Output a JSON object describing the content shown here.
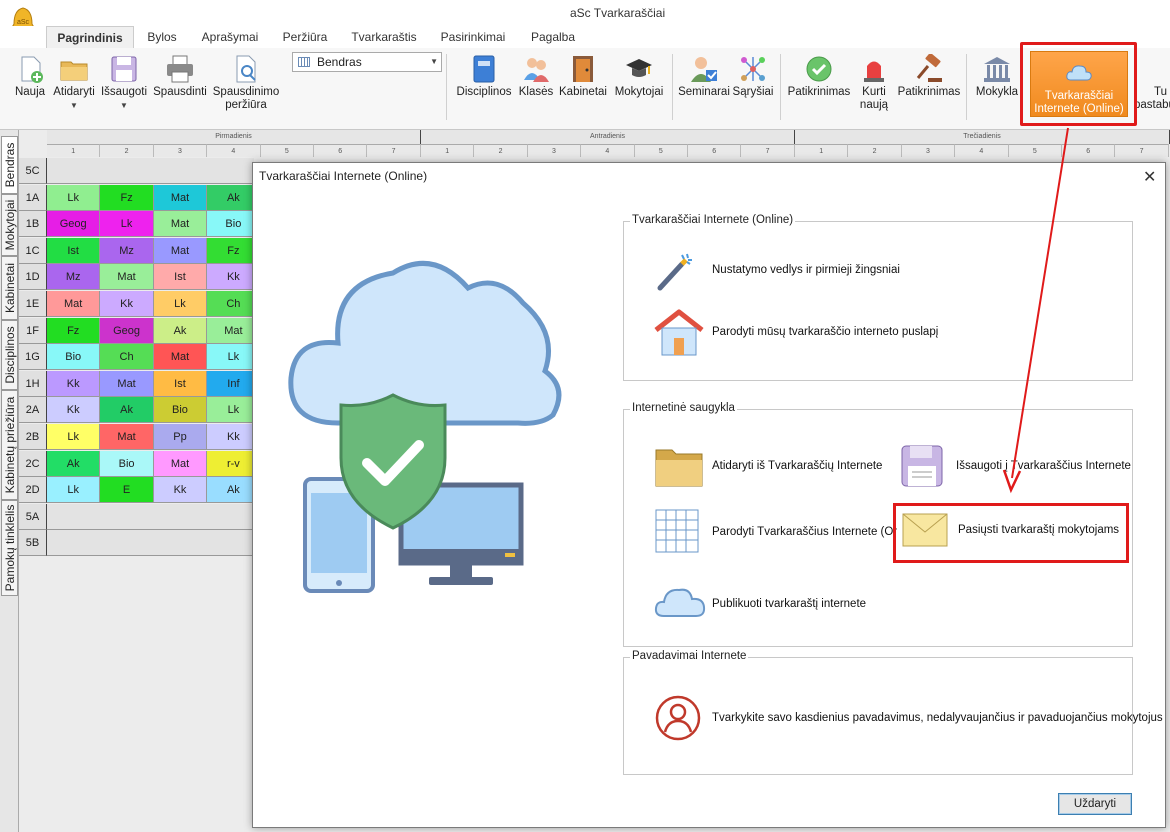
{
  "window": {
    "title": "aSc Tvarkaraščiai",
    "logo_text": "aSc"
  },
  "menu_tabs": [
    "Pagrindinis",
    "Bylos",
    "Aprašymai",
    "Peržiūra",
    "Tvarkaraštis",
    "Pasirinkimai",
    "Pagalba"
  ],
  "ribbon": {
    "buttons": [
      {
        "label": "Nauja",
        "icon": "new-document-icon"
      },
      {
        "label": "Atidaryti",
        "icon": "folder-icon"
      },
      {
        "label": "Išsaugoti",
        "icon": "floppy-icon"
      },
      {
        "label": "Spausdinti",
        "icon": "printer-icon"
      },
      {
        "label": "Spausdinimo",
        "label2": "peržiūra",
        "icon": "print-preview-icon"
      },
      {
        "label": "Disciplinos",
        "icon": "book-icon"
      },
      {
        "label": "Klasės",
        "icon": "students-icon"
      },
      {
        "label": "Kabinetai",
        "icon": "door-icon"
      },
      {
        "label": "Mokytojai",
        "icon": "graduation-cap-icon"
      },
      {
        "label": "Seminarai",
        "icon": "seminar-icon"
      },
      {
        "label": "Sąryšiai",
        "icon": "relations-icon"
      },
      {
        "label": "Patikrinimas",
        "icon": "check-badge-icon"
      },
      {
        "label": "Kurti",
        "label2": "naują",
        "icon": "siren-icon"
      },
      {
        "label": "Patikrinimas",
        "icon": "gavel-icon"
      },
      {
        "label": "Mokykla",
        "icon": "school-icon"
      },
      {
        "label": "Tvarkaraščiai",
        "label2": "Internete (Online)",
        "icon": "cloud-icon"
      },
      {
        "label": "Tu",
        "label2": "pastabų",
        "icon": "notes-icon"
      }
    ],
    "combo_value": "Bendras"
  },
  "side_tabs": [
    "Bendras",
    "Mokytojai",
    "Kabinetai",
    "Disciplinos",
    "Kabinetų priežiūra",
    "Pamokų tinklelis"
  ],
  "grid": {
    "days": [
      "Pirmadienis",
      "Antradienis",
      "Trečiadienis"
    ],
    "periods": [
      "1",
      "2",
      "3",
      "4",
      "5",
      "6",
      "7"
    ],
    "rows": [
      {
        "label": "5C",
        "cells": []
      },
      {
        "label": "1A",
        "cells": [
          [
            "Lk",
            "#90ee90"
          ],
          [
            "Fz",
            "#22dd22"
          ],
          [
            "Mat",
            "#1ec8d8"
          ],
          [
            "Ak",
            "#33cc66"
          ]
        ]
      },
      {
        "label": "1B",
        "cells": [
          [
            "Geog",
            "#e61ee6"
          ],
          [
            "Lk",
            "#ee22ee"
          ],
          [
            "Mat",
            "#99ee99"
          ],
          [
            "Bio",
            "#88f8f8"
          ]
        ]
      },
      {
        "label": "1C",
        "cells": [
          [
            "Ist",
            "#22dd44"
          ],
          [
            "Mz",
            "#aa66ee"
          ],
          [
            "Mat",
            "#9999ff"
          ],
          [
            "Fz",
            "#33dd33"
          ]
        ]
      },
      {
        "label": "1D",
        "cells": [
          [
            "Mz",
            "#aa66ee"
          ],
          [
            "Mat",
            "#99ee99"
          ],
          [
            "Ist",
            "#ffaaaa"
          ],
          [
            "Kk",
            "#ccaaff"
          ]
        ]
      },
      {
        "label": "1E",
        "cells": [
          [
            "Mat",
            "#ff9999"
          ],
          [
            "Kk",
            "#ccaaff"
          ],
          [
            "Lk",
            "#ffcc66"
          ],
          [
            "Ch",
            "#55dd55"
          ]
        ]
      },
      {
        "label": "1F",
        "cells": [
          [
            "Fz",
            "#22dd22"
          ],
          [
            "Geog",
            "#cc33cc"
          ],
          [
            "Ak",
            "#ccee88"
          ],
          [
            "Mat",
            "#99ee99"
          ]
        ]
      },
      {
        "label": "1G",
        "cells": [
          [
            "Bio",
            "#88f8f8"
          ],
          [
            "Ch",
            "#55dd55"
          ],
          [
            "Mat",
            "#ff5555"
          ],
          [
            "Lk",
            "#88f8f8"
          ]
        ]
      },
      {
        "label": "1H",
        "cells": [
          [
            "Kk",
            "#bb99ff"
          ],
          [
            "Mat",
            "#9999ff"
          ],
          [
            "Ist",
            "#ffbb44"
          ],
          [
            "Inf",
            "#22aaee"
          ]
        ]
      },
      {
        "label": "2A",
        "cells": [
          [
            "Kk",
            "#ccccff"
          ],
          [
            "Ak",
            "#22cc66"
          ],
          [
            "Bio",
            "#cccc33"
          ],
          [
            "Lk",
            "#99ee99"
          ]
        ]
      },
      {
        "label": "2B",
        "cells": [
          [
            "Lk",
            "#ffff66"
          ],
          [
            "Mat",
            "#ff6666"
          ],
          [
            "Pp",
            "#aaaaee"
          ],
          [
            "Kk",
            "#ccccff"
          ]
        ]
      },
      {
        "label": "2C",
        "cells": [
          [
            "Ak",
            "#22dd66"
          ],
          [
            "Bio",
            "#aaf8f8"
          ],
          [
            "Mat",
            "#ff99ff"
          ],
          [
            "r-v",
            "#eeee33"
          ]
        ]
      },
      {
        "label": "2D",
        "cells": [
          [
            "Lk",
            "#99f0ff"
          ],
          [
            "E",
            "#22dd22"
          ],
          [
            "Kk",
            "#ccccff"
          ],
          [
            "Ak",
            "#99ddff"
          ]
        ]
      },
      {
        "label": "5A",
        "cells": []
      },
      {
        "label": "5B",
        "cells": []
      }
    ]
  },
  "dialog": {
    "title": "Tvarkaraščiai Internete (Online)",
    "close_symbol": "✕",
    "groups": [
      {
        "title": "Tvarkaraščiai Internete (Online)",
        "items": [
          {
            "label": "Nustatymo vedlys ir pirmieji žingsniai",
            "icon": "magic-wand-icon"
          },
          {
            "label": "Parodyti mūsų tvarkaraščio interneto puslapį",
            "icon": "house-icon"
          }
        ]
      },
      {
        "title": "Internetinė saugykla",
        "items": [
          {
            "label": "Atidaryti iš Tvarkaraščių Internete",
            "icon": "folder-icon"
          },
          {
            "label": "Išsaugoti į Tvarkaraščius Internete",
            "icon": "floppy-icon"
          },
          {
            "label": "Parodyti Tvarkaraščius Internete (Or",
            "icon": "table-icon"
          },
          {
            "label": "Pasiųsti tvarkaraštį mokytojams",
            "icon": "envelope-icon"
          },
          {
            "label": "Publikuoti tvarkaraštį internete",
            "icon": "cloud-icon"
          }
        ]
      },
      {
        "title": "Pavadavimai Internete",
        "items": [
          {
            "label": "Tvarkykite savo kasdienius pavadavimus, nedalyvaujančius ir pavaduojančius mokytojus",
            "icon": "person-outline-icon"
          }
        ]
      }
    ],
    "close_button": "Uždaryti"
  },
  "colors": {
    "highlight": "#e01a1a",
    "online_button": "#f5952e",
    "accent_blue": "#3c7fb1"
  }
}
